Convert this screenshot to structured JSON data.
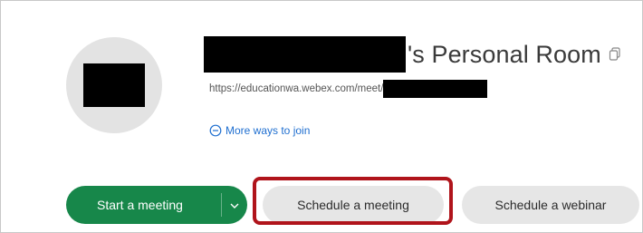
{
  "room": {
    "title_suffix": "'s Personal Room",
    "url": "https://educationwa.webex.com/meet/",
    "more_ways": "More ways to join"
  },
  "actions": {
    "start_meeting": "Start a meeting",
    "schedule_meeting": "Schedule a meeting",
    "schedule_webinar": "Schedule a webinar"
  },
  "colors": {
    "start_button": "#17874a",
    "link": "#1f6fd0",
    "highlight": "#b0141b"
  }
}
